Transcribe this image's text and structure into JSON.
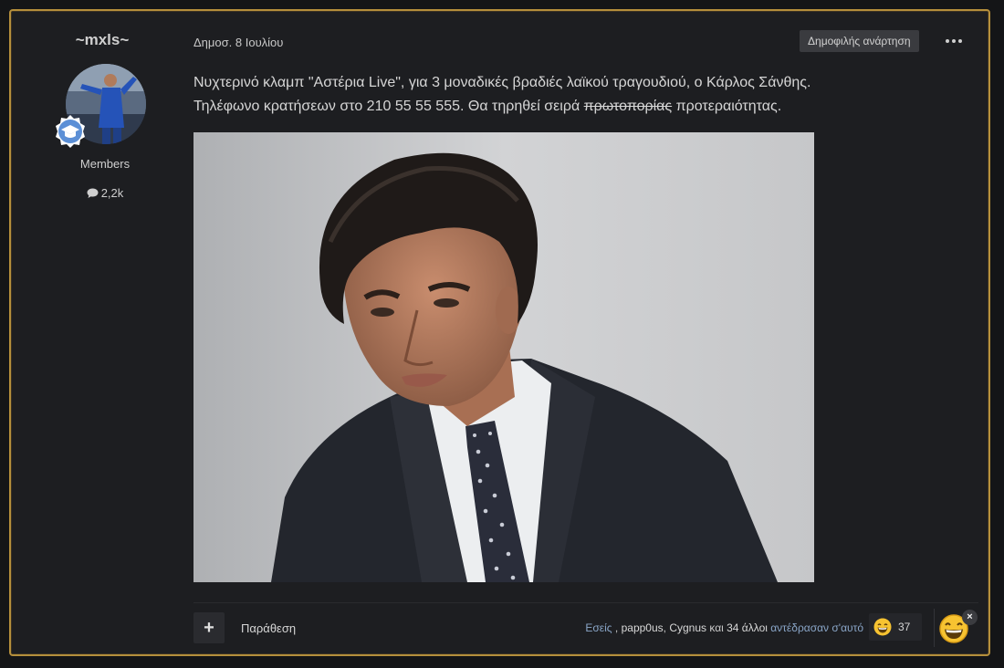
{
  "author": {
    "name": "~mxls~",
    "group": "Members",
    "post_count": "2,2k"
  },
  "post": {
    "date": "Δημοσ. 8 Ιουλίου",
    "popular_label": "Δημοφιλής ανάρτηση",
    "line1": "Νυχτερινό κλαμπ \"Αστέρια Live\", για 3 μοναδικές βραδιές λαϊκού τραγουδιού, ο Κάρλος Σάνθης.",
    "line2_before": "Τηλέφωνο κρατήσεων στο 210 55 55 555. Θα τηρηθεί σειρά ",
    "line2_strike": "πρωτοπορίας",
    "line2_after": " προτεραιότητας."
  },
  "controls": {
    "plus_label": "+",
    "quote_label": "Παράθεση",
    "close_label": "×"
  },
  "reactions": {
    "you": "Εσείς",
    "sep1": " , ",
    "user1": "papp0us",
    "sep2": ", ",
    "user2": "Cygnus",
    "and": " και ",
    "others": "34 άλλοι",
    "reacted": " αντέδρασαν σ'αυτό",
    "count": "37"
  },
  "icons": {
    "more": "ellipsis-icon",
    "comment": "speech-bubble-icon",
    "badge": "graduation-cap-badge-icon",
    "reaction": "laughing-face-icon"
  },
  "colors": {
    "border": "#b58f3c",
    "background": "#1d1e21",
    "link": "#8aa6c8",
    "badge": "#5b8fd6"
  }
}
